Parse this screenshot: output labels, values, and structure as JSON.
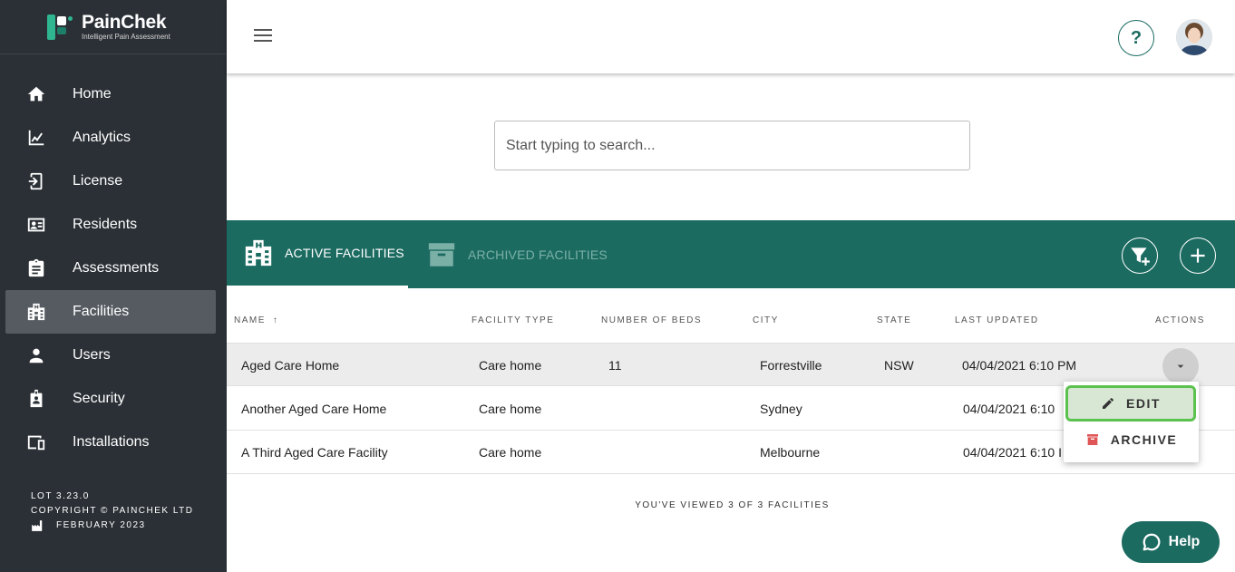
{
  "brand": {
    "name": "PainChek",
    "tagline": "Intelligent Pain Assessment"
  },
  "sidebar": {
    "items": [
      {
        "label": "Home",
        "icon": "home-icon"
      },
      {
        "label": "Analytics",
        "icon": "analytics-icon"
      },
      {
        "label": "License",
        "icon": "license-icon"
      },
      {
        "label": "Residents",
        "icon": "residents-icon"
      },
      {
        "label": "Assessments",
        "icon": "assessments-icon"
      },
      {
        "label": "Facilities",
        "icon": "facilities-icon",
        "active": true
      },
      {
        "label": "Users",
        "icon": "users-icon"
      },
      {
        "label": "Security",
        "icon": "security-icon"
      },
      {
        "label": "Installations",
        "icon": "installations-icon"
      }
    ],
    "footer": {
      "version": "LOT 3.23.0",
      "copyright": "COPYRIGHT © PAINCHEK LTD",
      "date": "FEBRUARY 2023"
    }
  },
  "topbar": {
    "help_symbol": "?"
  },
  "search": {
    "placeholder": "Start typing to search..."
  },
  "tabs": {
    "active": "ACTIVE FACILITIES",
    "archived": "ARCHIVED FACILITIES"
  },
  "table": {
    "columns": {
      "name": "NAME",
      "sort_arrow": "↑",
      "type": "FACILITY TYPE",
      "beds": "NUMBER OF BEDS",
      "city": "CITY",
      "state": "STATE",
      "updated": "LAST UPDATED",
      "actions": "ACTIONS"
    },
    "rows": [
      {
        "name": "Aged Care Home",
        "type": "Care home",
        "beds": "11",
        "city": "Forrestville",
        "state": "NSW",
        "updated": "04/04/2021 6:10 PM"
      },
      {
        "name": "Another Aged Care Home",
        "type": "Care home",
        "beds": "",
        "city": "Sydney",
        "state": "",
        "updated": "04/04/2021 6:10"
      },
      {
        "name": "A Third Aged Care Facility",
        "type": "Care home",
        "beds": "",
        "city": "Melbourne",
        "state": "",
        "updated": "04/04/2021 6:10 I"
      }
    ],
    "viewed_text": "YOU'VE VIEWED 3 OF 3 FACILITIES"
  },
  "dropdown": {
    "edit": "EDIT",
    "archive": "ARCHIVE"
  },
  "help_button": {
    "label": "Help"
  },
  "colors": {
    "teal": "#1c6b61",
    "sidebar": "#2b3036",
    "edit_highlight": "#5cc24f",
    "archive_icon": "#e05555"
  }
}
